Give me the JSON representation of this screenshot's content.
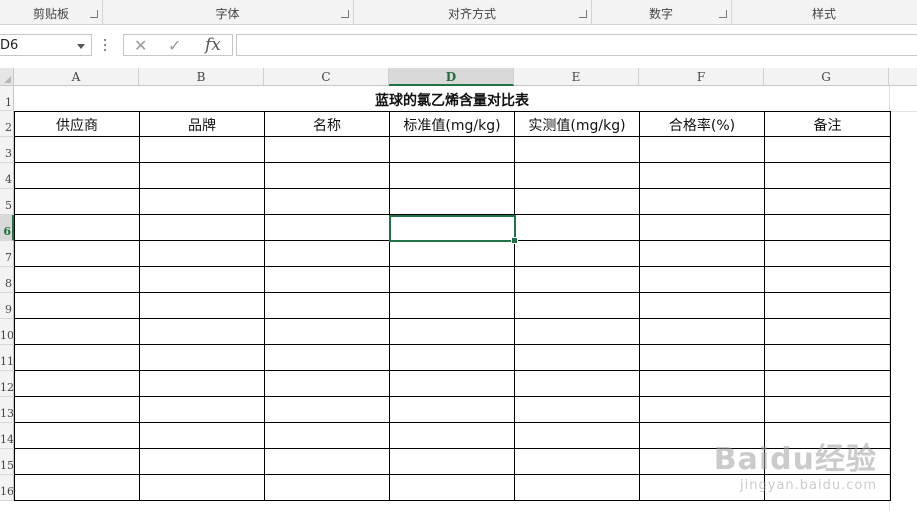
{
  "ribbon": {
    "groups": [
      {
        "label": "剪贴板"
      },
      {
        "label": "字体"
      },
      {
        "label": "对齐方式"
      },
      {
        "label": "数字"
      },
      {
        "label": "样式"
      }
    ]
  },
  "formula_bar": {
    "name_box": "D6",
    "cancel_icon": "✕",
    "enter_icon": "✓",
    "fx_label": "fx",
    "formula": ""
  },
  "columns": [
    "A",
    "B",
    "C",
    "D",
    "E",
    "F",
    "G"
  ],
  "selected_column": "D",
  "rows": [
    "1",
    "2",
    "3",
    "4",
    "5",
    "6",
    "7",
    "8",
    "9",
    "10",
    "11",
    "12",
    "13",
    "14",
    "15",
    "16"
  ],
  "selected_row": "6",
  "sheet": {
    "title": "蓝球的氯乙烯含量对比表",
    "headers": [
      "供应商",
      "品牌",
      "名称",
      "标准值(mg/kg)",
      "实测值(mg/kg)",
      "合格率(%)",
      "备注"
    ]
  },
  "watermark": {
    "brand": "Baidu经验",
    "url": "jingyan.baidu.com"
  },
  "colors": {
    "accent": "#217346",
    "header_bg": "#f3f3f3",
    "selected_header_bg": "#d9d9d9"
  }
}
